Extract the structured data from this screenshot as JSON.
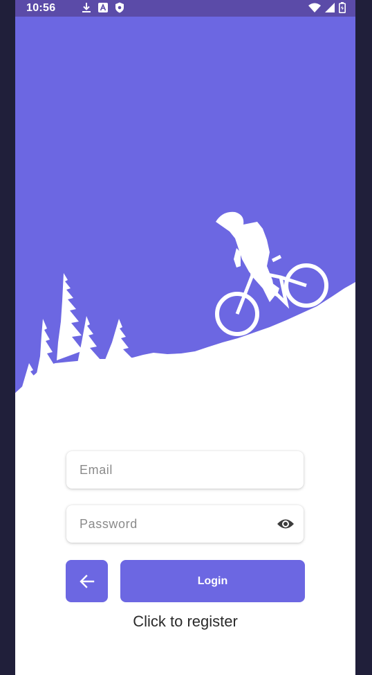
{
  "status_bar": {
    "time": "10:56",
    "left_icons": [
      "download-icon",
      "text-a-icon",
      "shield-icon"
    ],
    "right_icons": [
      "wifi-icon",
      "signal-icon",
      "battery-icon"
    ],
    "background_color": "#5b4ba8"
  },
  "hero": {
    "sky_color": "#6c67e2",
    "ground_color": "#ffffff"
  },
  "form": {
    "email_placeholder": "Email",
    "email_value": "",
    "password_placeholder": "Password",
    "password_value": "",
    "password_toggle_icon": "eye-icon"
  },
  "actions": {
    "back_icon": "arrow-left-icon",
    "login_label": "Login",
    "register_label": "Click to register",
    "accent_color": "#6c67e2"
  }
}
